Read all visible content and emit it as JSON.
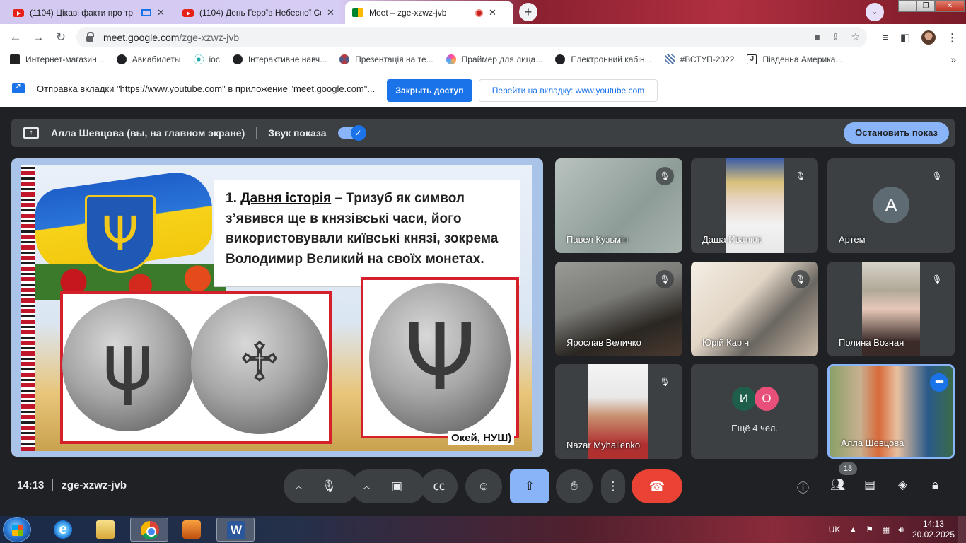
{
  "browser": {
    "tabs": [
      {
        "label": "(1104) Цікаві факти про тр"
      },
      {
        "label": "(1104) День Героїв Небесної Со"
      },
      {
        "label": "Meet – zge-xzwz-jvb"
      }
    ],
    "new_tab": "+",
    "tab_search": "⌄",
    "url_host": "meet.google.com",
    "url_path": "/zge-xzwz-jvb",
    "bookmarks": [
      {
        "label": "Интернет-магазин..."
      },
      {
        "label": "Авиабилеты"
      },
      {
        "label": "ioc"
      },
      {
        "label": "Інтерактивне навч..."
      },
      {
        "label": "Презентація на те..."
      },
      {
        "label": "Праймер для лица..."
      },
      {
        "label": "Електронний кабін..."
      },
      {
        "label": "#ВСТУП-2022"
      },
      {
        "label": "Південна Америка..."
      }
    ],
    "bookmarks_more": "»"
  },
  "infobar": {
    "message": "Отправка вкладки \"https://www.youtube.com\" в приложение \"meet.google.com\"...",
    "stop_sharing": "Закрыть доступ",
    "go_to_tab": "Перейти на вкладку: www.youtube.com"
  },
  "presenting": {
    "title": "Алла Шевцова (вы, на главном экране)",
    "sound_label": "Звук показа",
    "stop_button": "Остановить показ"
  },
  "slide": {
    "num": "1.",
    "term": "Давня історія",
    "text": " – Тризуб як символ з’явився ще в князівські часи, його використовували київські князі, зокрема Володимир Великий на своїх монетах.",
    "label": "Окей, НУШ)",
    "coin1": "ψ",
    "coin2": "♱",
    "coin3": "Ψ",
    "shield": "Ψ"
  },
  "participants": [
    {
      "name": "Павел Кузьмін"
    },
    {
      "name": "Даша Иванюк"
    },
    {
      "name": "Артем",
      "initial": "А"
    },
    {
      "name": "Ярослав Величко"
    },
    {
      "name": "Юрій Карін"
    },
    {
      "name": "Полина Возная"
    },
    {
      "name": "Nazar Myhailenko"
    },
    {
      "more_initial_1": "И",
      "more_initial_2": "О",
      "label": "Ещё 4 чел."
    },
    {
      "name": "Алла Шевцова"
    }
  ],
  "controls": {
    "time": "14:13",
    "meeting_code": "zge-xzwz-jvb",
    "people_count": "13"
  },
  "taskbar": {
    "lang": "UK",
    "time": "14:13",
    "date": "20.02.2025",
    "word_letter": "W",
    "ie_letter": "e"
  },
  "colors": {
    "meet_bg": "#202124",
    "accent_blue": "#1a73e8",
    "light_blue": "#8ab4f8",
    "hangup_red": "#ea4335"
  }
}
